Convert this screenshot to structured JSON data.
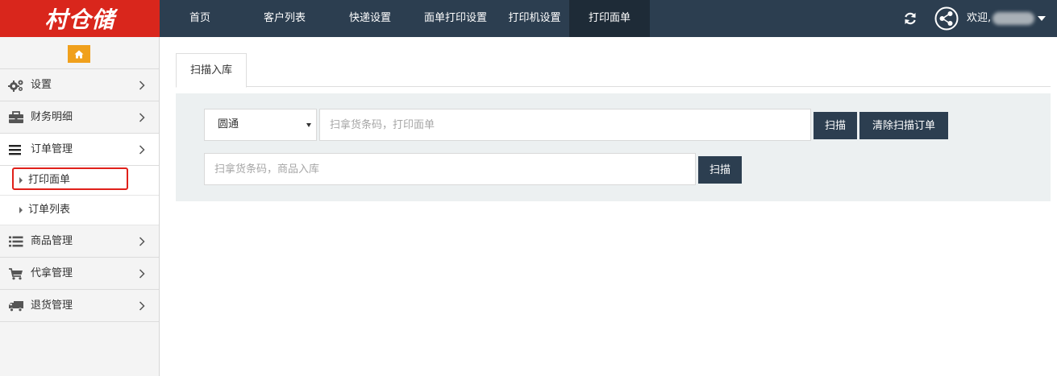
{
  "app": {
    "logo_text": "村仓储"
  },
  "nav": {
    "items": [
      {
        "label": "首页"
      },
      {
        "label": "客户列表"
      },
      {
        "label": "快递设置"
      },
      {
        "label": "面单打印设置"
      },
      {
        "label": "打印机设置"
      },
      {
        "label": "打印面单",
        "active": true
      }
    ]
  },
  "user": {
    "welcome": "欢迎,"
  },
  "sidebar": {
    "menu": [
      {
        "label": "设置",
        "icon": "gears-icon"
      },
      {
        "label": "财务明细",
        "icon": "briefcase-icon"
      },
      {
        "label": "订单管理",
        "icon": "bars-icon",
        "expanded": true
      }
    ],
    "submenu": [
      {
        "label": "打印面单",
        "highlighted": true
      },
      {
        "label": "订单列表"
      }
    ],
    "menu_after": [
      {
        "label": "商品管理",
        "icon": "list-icon"
      },
      {
        "label": "代拿管理",
        "icon": "cart-icon"
      },
      {
        "label": "退货管理",
        "icon": "truck-icon"
      }
    ]
  },
  "main": {
    "tab_label": "扫描入库",
    "courier_select": {
      "value": "圆通"
    },
    "print_input": {
      "placeholder": "扫拿货条码，打印面单",
      "value": ""
    },
    "scan_button": "扫描",
    "clear_button": "清除扫描订单",
    "stock_input": {
      "placeholder": "扫拿货条码，商品入库",
      "value": ""
    },
    "scan_button_2": "扫描"
  },
  "colors": {
    "topbar": "#2c3e50",
    "logo_bg": "#d9261c",
    "active_nav": "#1e2b37",
    "home_button": "#f0a01c",
    "highlight": "#e0201a",
    "panel": "#ecf0f1"
  }
}
